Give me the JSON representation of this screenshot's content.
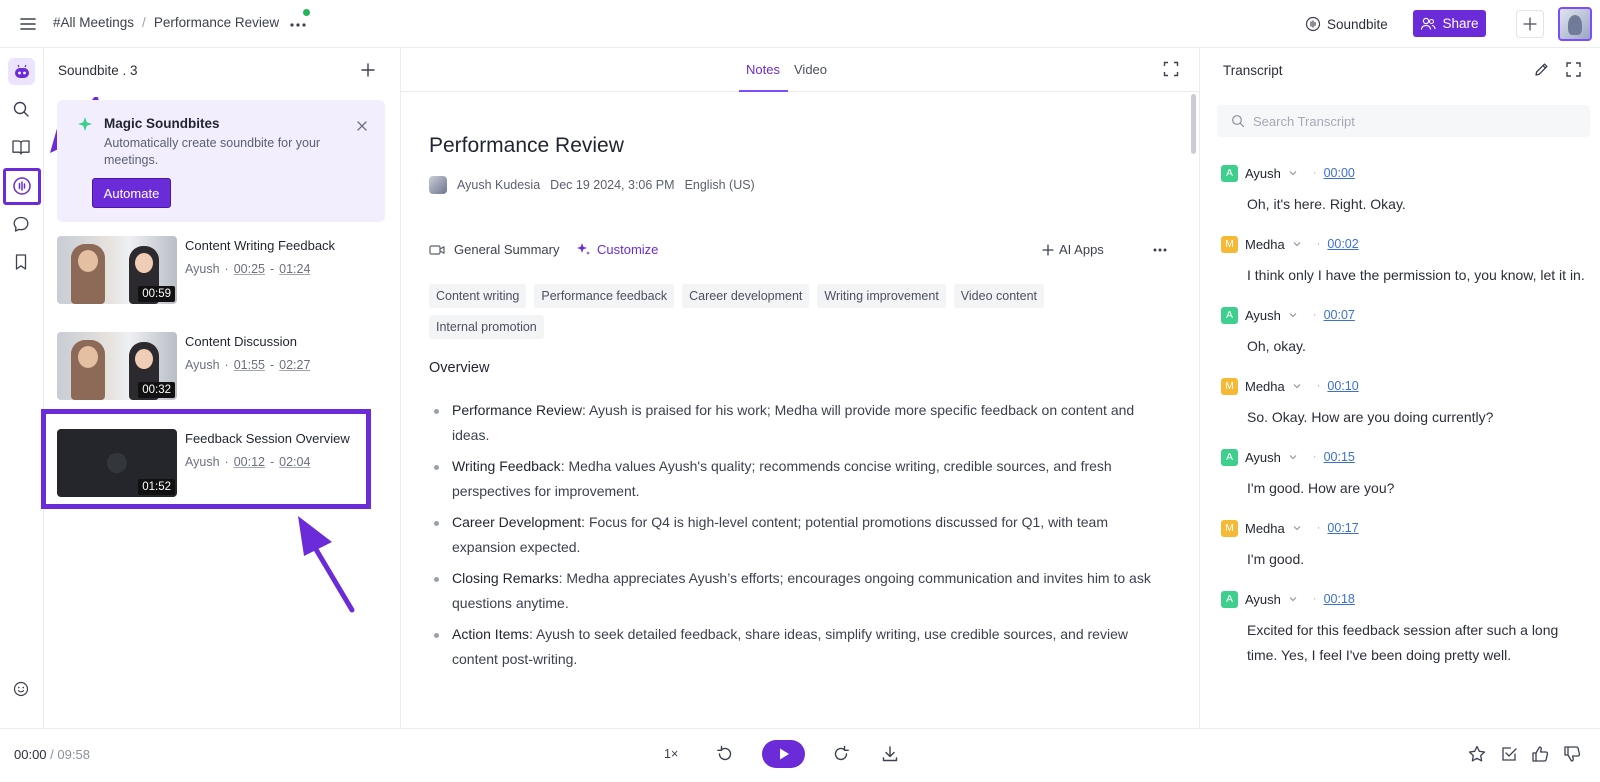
{
  "breadcrumb": {
    "root": "#All Meetings",
    "separator": "/",
    "current": "Performance Review"
  },
  "topbar": {
    "soundbite_label": "Soundbite",
    "share_label": "Share"
  },
  "soundbites": {
    "header": "Soundbite . 3",
    "magic": {
      "title": "Magic Soundbites",
      "description": "Automatically create soundbite for your meetings.",
      "button": "Automate"
    },
    "clips": [
      {
        "title": "Content Writing Feedback",
        "speaker": "Ayush",
        "start": "00:25",
        "end": "01:24",
        "duration": "00:59"
      },
      {
        "title": "Content Discussion",
        "speaker": "Ayush",
        "start": "01:55",
        "end": "02:27",
        "duration": "00:32"
      },
      {
        "title": "Feedback Session Overview",
        "speaker": "Ayush",
        "start": "00:12",
        "end": "02:04",
        "duration": "01:52"
      }
    ]
  },
  "main": {
    "tabs": [
      "Notes",
      "Video"
    ],
    "active_tab": "Notes",
    "title": "Performance Review",
    "meta": {
      "author": "Ayush Kudesia",
      "date": "Dec 19 2024, 3:06 PM",
      "language": "English (US)"
    },
    "summary_type": "General Summary",
    "customize_label": "Customize",
    "ai_apps_label": "AI Apps",
    "tags": [
      "Content writing",
      "Performance feedback",
      "Career development",
      "Writing improvement",
      "Video content",
      "Internal promotion"
    ],
    "overview_heading": "Overview",
    "bullets": [
      {
        "label": "Performance Review",
        "text": ": Ayush is praised for his work; Medha will provide more specific feedback on content and ideas."
      },
      {
        "label": "Writing Feedback",
        "text": ": Medha values Ayush's quality; recommends concise writing, credible sources, and fresh perspectives for improvement."
      },
      {
        "label": "Career Development",
        "text": ": Focus for Q4 is high-level content; potential promotions discussed for Q1, with team expansion expected."
      },
      {
        "label": "Closing Remarks",
        "text": ": Medha appreciates Ayush’s efforts; encourages ongoing communication and invites him to ask questions anytime."
      },
      {
        "label": "Action Items",
        "text": ": Ayush to seek detailed feedback, share ideas, simplify writing, use credible sources, and review content post-writing."
      }
    ]
  },
  "transcript": {
    "title": "Transcript",
    "search_placeholder": "Search Transcript",
    "entries": [
      {
        "initial": "A",
        "speaker": "Ayush",
        "color": "#3ecf8e",
        "time": "00:00",
        "text": "Oh, it's here. Right. Okay."
      },
      {
        "initial": "M",
        "speaker": "Medha",
        "color": "#f5b935",
        "time": "00:02",
        "text": "I think only I have the permission to, you know, let it in."
      },
      {
        "initial": "A",
        "speaker": "Ayush",
        "color": "#3ecf8e",
        "time": "00:07",
        "text": "Oh, okay."
      },
      {
        "initial": "M",
        "speaker": "Medha",
        "color": "#f5b935",
        "time": "00:10",
        "text": "So. Okay. How are you doing currently?"
      },
      {
        "initial": "A",
        "speaker": "Ayush",
        "color": "#3ecf8e",
        "time": "00:15",
        "text": "I'm good. How are you?"
      },
      {
        "initial": "M",
        "speaker": "Medha",
        "color": "#f5b935",
        "time": "00:17",
        "text": "I'm good."
      },
      {
        "initial": "A",
        "speaker": "Ayush",
        "color": "#3ecf8e",
        "time": "00:18",
        "text": "Excited for this feedback session after such a long time. Yes, I feel I've been doing pretty well."
      }
    ]
  },
  "player": {
    "current": "00:00",
    "separator": "/",
    "total": "09:58",
    "speed": "1×"
  },
  "colors": {
    "accent": "#6c2bd9",
    "link": "#3a6fd8",
    "ayush": "#3ecf8e",
    "medha": "#f5b935"
  }
}
